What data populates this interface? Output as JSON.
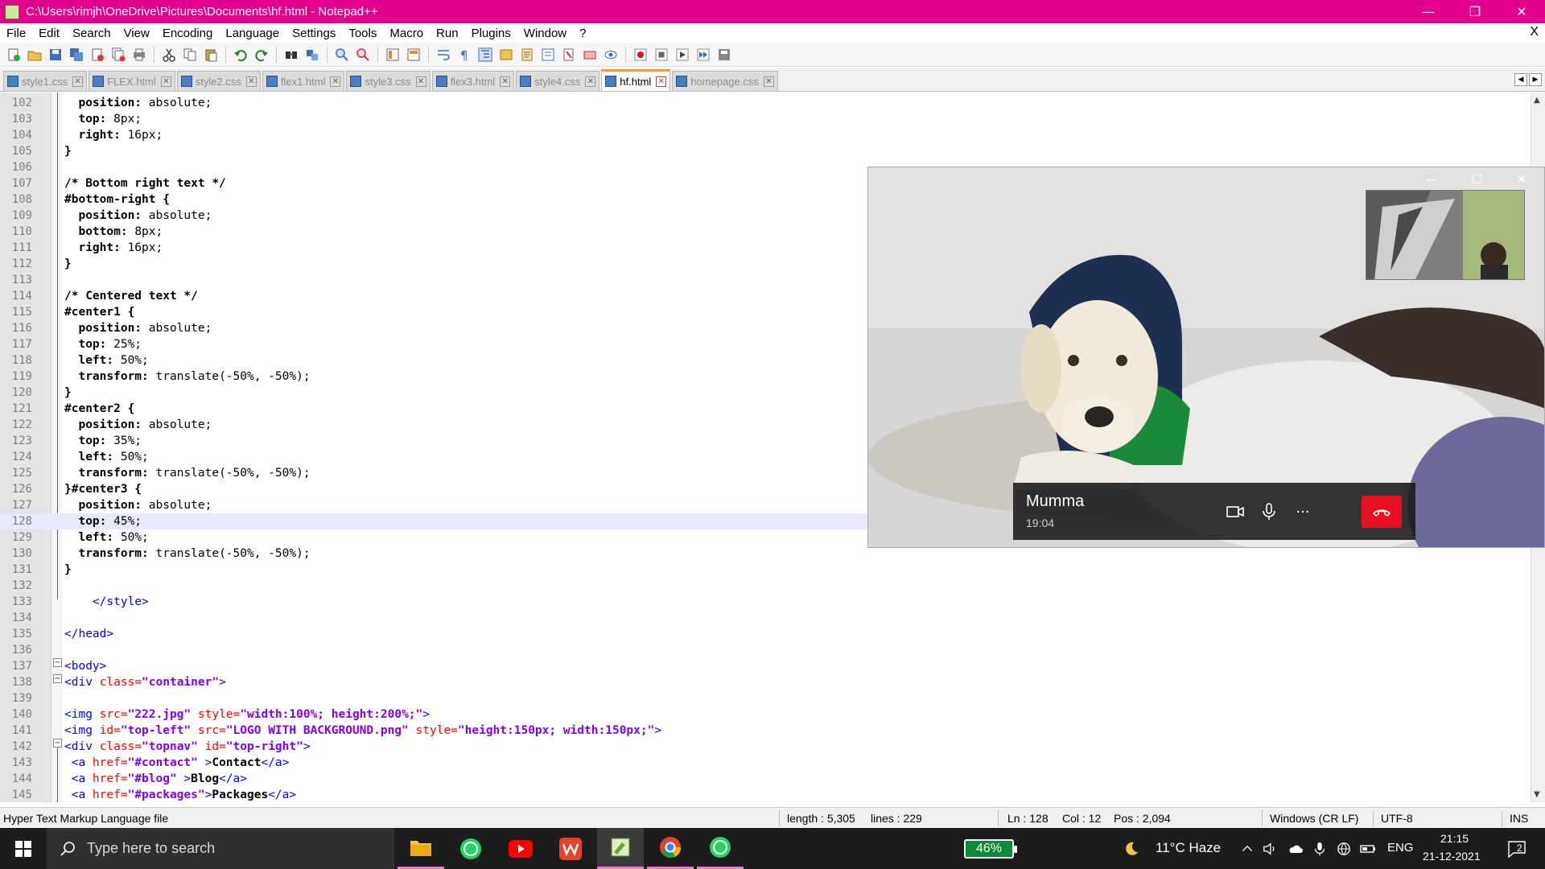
{
  "window": {
    "title": "C:\\Users\\rimjh\\OneDrive\\Pictures\\Documents\\hf.html - Notepad++",
    "controls": {
      "minimize": "—",
      "restore": "❐",
      "close": "✕"
    }
  },
  "menu": {
    "items": [
      "File",
      "Edit",
      "Search",
      "View",
      "Encoding",
      "Language",
      "Settings",
      "Tools",
      "Macro",
      "Run",
      "Plugins",
      "Window",
      "?"
    ],
    "close": "X"
  },
  "tabs": [
    {
      "label": "style1.css",
      "active": false
    },
    {
      "label": "FLEX.html",
      "active": false
    },
    {
      "label": "style2.css",
      "active": false
    },
    {
      "label": "flex1.html",
      "active": false
    },
    {
      "label": "style3.css",
      "active": false
    },
    {
      "label": "flex3.html",
      "active": false
    },
    {
      "label": "style4.css",
      "active": false
    },
    {
      "label": "hf.html",
      "active": true
    },
    {
      "label": "homepage.css",
      "active": false
    }
  ],
  "editor": {
    "current_line": 128,
    "lines": [
      {
        "n": "102",
        "segs": [
          [
            "prop",
            "  position: "
          ],
          [
            "val",
            "absolute;"
          ]
        ]
      },
      {
        "n": "103",
        "segs": [
          [
            "prop",
            "  top: "
          ],
          [
            "val",
            "8px;"
          ]
        ]
      },
      {
        "n": "104",
        "segs": [
          [
            "prop",
            "  right: "
          ],
          [
            "val",
            "16px;"
          ]
        ]
      },
      {
        "n": "105",
        "segs": [
          [
            "sel",
            "}"
          ]
        ]
      },
      {
        "n": "106",
        "segs": []
      },
      {
        "n": "107",
        "segs": [
          [
            "comment",
            "/* Bottom right text */"
          ]
        ]
      },
      {
        "n": "108",
        "segs": [
          [
            "sel",
            "#bottom-right {"
          ]
        ]
      },
      {
        "n": "109",
        "segs": [
          [
            "prop",
            "  position: "
          ],
          [
            "val",
            "absolute;"
          ]
        ]
      },
      {
        "n": "110",
        "segs": [
          [
            "prop",
            "  bottom: "
          ],
          [
            "val",
            "8px;"
          ]
        ]
      },
      {
        "n": "111",
        "segs": [
          [
            "prop",
            "  right: "
          ],
          [
            "val",
            "16px;"
          ]
        ]
      },
      {
        "n": "112",
        "segs": [
          [
            "sel",
            "}"
          ]
        ]
      },
      {
        "n": "113",
        "segs": []
      },
      {
        "n": "114",
        "segs": [
          [
            "comment",
            "/* Centered text */"
          ]
        ]
      },
      {
        "n": "115",
        "segs": [
          [
            "sel",
            "#center1 {"
          ]
        ]
      },
      {
        "n": "116",
        "segs": [
          [
            "prop",
            "  position: "
          ],
          [
            "val",
            "absolute;"
          ]
        ]
      },
      {
        "n": "117",
        "segs": [
          [
            "prop",
            "  top: "
          ],
          [
            "val",
            "25%;"
          ]
        ]
      },
      {
        "n": "118",
        "segs": [
          [
            "prop",
            "  left: "
          ],
          [
            "val",
            "50%;"
          ]
        ]
      },
      {
        "n": "119",
        "segs": [
          [
            "prop",
            "  transform: "
          ],
          [
            "val",
            "translate(-50%, -50%);"
          ]
        ]
      },
      {
        "n": "120",
        "segs": [
          [
            "sel",
            "}"
          ]
        ]
      },
      {
        "n": "121",
        "segs": [
          [
            "sel",
            "#center2 {"
          ]
        ]
      },
      {
        "n": "122",
        "segs": [
          [
            "prop",
            "  position: "
          ],
          [
            "val",
            "absolute;"
          ]
        ]
      },
      {
        "n": "123",
        "segs": [
          [
            "prop",
            "  top: "
          ],
          [
            "val",
            "35%;"
          ]
        ]
      },
      {
        "n": "124",
        "segs": [
          [
            "prop",
            "  left: "
          ],
          [
            "val",
            "50%;"
          ]
        ]
      },
      {
        "n": "125",
        "segs": [
          [
            "prop",
            "  transform: "
          ],
          [
            "val",
            "translate(-50%, -50%);"
          ]
        ]
      },
      {
        "n": "126",
        "segs": [
          [
            "sel",
            "}#center3 {"
          ]
        ]
      },
      {
        "n": "127",
        "segs": [
          [
            "prop",
            "  position: "
          ],
          [
            "val",
            "absolute;"
          ]
        ]
      },
      {
        "n": "128",
        "segs": [
          [
            "prop",
            "  top: "
          ],
          [
            "val",
            "45%;"
          ]
        ]
      },
      {
        "n": "129",
        "segs": [
          [
            "prop",
            "  left: "
          ],
          [
            "val",
            "50%;"
          ]
        ]
      },
      {
        "n": "130",
        "segs": [
          [
            "prop",
            "  transform: "
          ],
          [
            "val",
            "translate(-50%, -50%);"
          ]
        ]
      },
      {
        "n": "131",
        "segs": [
          [
            "sel",
            "}"
          ]
        ]
      },
      {
        "n": "132",
        "segs": []
      },
      {
        "n": "133",
        "segs": [
          [
            "tag",
            "    </style>"
          ]
        ]
      },
      {
        "n": "134",
        "segs": []
      },
      {
        "n": "135",
        "segs": [
          [
            "tag",
            "</head>"
          ]
        ]
      },
      {
        "n": "136",
        "segs": []
      },
      {
        "n": "137",
        "segs": [
          [
            "tag",
            "<body>"
          ]
        ]
      },
      {
        "n": "138",
        "segs": [
          [
            "tag",
            "<div "
          ],
          [
            "attr",
            "class="
          ],
          [
            "str",
            "\"container\""
          ],
          [
            "tag",
            ">"
          ]
        ]
      },
      {
        "n": "139",
        "segs": []
      },
      {
        "n": "140",
        "segs": [
          [
            "tag",
            "<img "
          ],
          [
            "attr",
            "src="
          ],
          [
            "str",
            "\"222.jpg\" "
          ],
          [
            "attr",
            "style="
          ],
          [
            "str",
            "\"width:100%; height:200%;\""
          ],
          [
            "tag",
            ">"
          ]
        ]
      },
      {
        "n": "141",
        "segs": [
          [
            "tag",
            "<img "
          ],
          [
            "attr",
            "id="
          ],
          [
            "str",
            "\"top-left\" "
          ],
          [
            "attr",
            "src="
          ],
          [
            "str",
            "\"LOGO WITH BACKGROUND.png\" "
          ],
          [
            "attr",
            "style="
          ],
          [
            "str",
            "\"height:150px; width:150px;\""
          ],
          [
            "tag",
            ">"
          ]
        ]
      },
      {
        "n": "142",
        "segs": [
          [
            "tag",
            "<div "
          ],
          [
            "attr",
            "class="
          ],
          [
            "str",
            "\"topnav\" "
          ],
          [
            "attr",
            "id="
          ],
          [
            "str",
            "\"top-right\""
          ],
          [
            "tag",
            ">"
          ]
        ]
      },
      {
        "n": "143",
        "segs": [
          [
            "tag",
            " <a "
          ],
          [
            "attr",
            "href="
          ],
          [
            "str",
            "\"#contact\" "
          ],
          [
            "tag",
            ">"
          ],
          [
            "text",
            "Contact"
          ],
          [
            "tag",
            "</a>"
          ]
        ]
      },
      {
        "n": "144",
        "segs": [
          [
            "tag",
            " <a "
          ],
          [
            "attr",
            "href="
          ],
          [
            "str",
            "\"#blog\" "
          ],
          [
            "tag",
            ">"
          ],
          [
            "text",
            "Blog"
          ],
          [
            "tag",
            "</a>"
          ]
        ]
      },
      {
        "n": "145",
        "segs": [
          [
            "tag",
            " <a "
          ],
          [
            "attr",
            "href="
          ],
          [
            "str",
            "\"#packages\""
          ],
          [
            "tag",
            ">"
          ],
          [
            "text",
            "Packages"
          ],
          [
            "tag",
            "</a>"
          ]
        ]
      }
    ]
  },
  "statusbar": {
    "file_type": "Hyper Text Markup Language file",
    "length": "length : 5,305",
    "lines": "lines : 229",
    "ln": "Ln : 128",
    "col": "Col : 12",
    "pos": "Pos : 2,094",
    "eol": "Windows (CR LF)",
    "encoding": "UTF-8",
    "mode": "INS"
  },
  "call": {
    "name": "Mumma",
    "duration": "19:04",
    "more_label": "···"
  },
  "taskbar": {
    "search_placeholder": "Type here to search",
    "battery": "46%",
    "weather": "11°C  Haze",
    "language": "ENG",
    "time": "21:15",
    "date": "21-12-2021",
    "notifications": "2",
    "colors": {
      "accent": "#e3008c",
      "taskbar": "#1c1c1c",
      "end_call": "#e81123"
    }
  }
}
